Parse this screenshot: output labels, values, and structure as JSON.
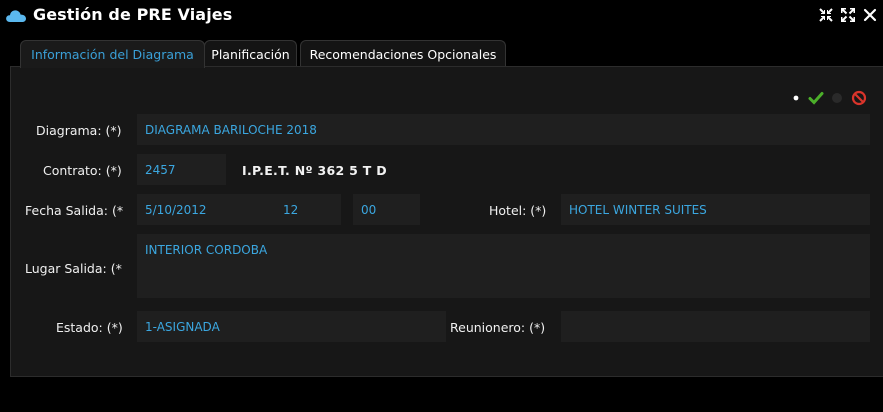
{
  "window": {
    "title": "Gestión de PRE Viajes",
    "icons": [
      "cloud-icon",
      "collapse-icon",
      "expand-icon",
      "close-icon"
    ]
  },
  "tabs": [
    {
      "label": "Información del Diagrama",
      "active": true
    },
    {
      "label": "Planificación",
      "active": false
    },
    {
      "label": "Recomendaciones Opcionales",
      "active": false
    }
  ],
  "status_icons": [
    "dot-icon",
    "check-icon",
    "disabled-dot-icon",
    "cancel-icon"
  ],
  "form": {
    "diagrama": {
      "label": "Diagrama: (*)",
      "value": "DIAGRAMA BARILOCHE 2018"
    },
    "contrato": {
      "label": "Contrato: (*)",
      "value": "2457",
      "school": "I.P.E.T. Nº 362 5 T D"
    },
    "fecha_salida": {
      "label": "Fecha Salida: (*",
      "date": "5/10/2012",
      "hour": "12",
      "minute": "00"
    },
    "hotel": {
      "label": "Hotel: (*)",
      "value": "HOTEL WINTER SUITES"
    },
    "lugar_salida": {
      "label": "Lugar Salida: (*",
      "value": "INTERIOR CORDOBA"
    },
    "estado": {
      "label": "Estado: (*)",
      "value": "1-ASIGNADA"
    },
    "reunionero": {
      "label": "Reunionero: (*)",
      "value": ""
    }
  },
  "colors": {
    "accent": "#3aa0d8",
    "field_text": "#3ba7e0",
    "check": "#4caf2a",
    "cancel": "#d9342b"
  }
}
